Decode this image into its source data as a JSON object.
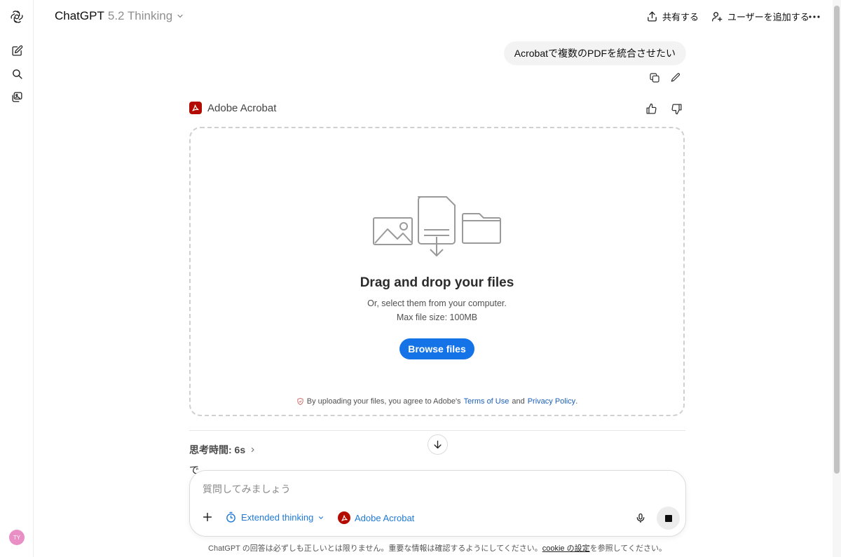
{
  "header": {
    "app_name": "ChatGPT",
    "model_label": "5.2 Thinking",
    "share_label": "共有する",
    "add_user_label": "ユーザーを追加する"
  },
  "sidebar": {
    "items": [
      {
        "icon": "chatgpt-logo-icon"
      },
      {
        "icon": "new-chat-icon"
      },
      {
        "icon": "search-icon"
      },
      {
        "icon": "library-icon"
      }
    ],
    "avatar_initials": "TY"
  },
  "conversation": {
    "user_message": "Acrobatで複数のPDFを統合させたい",
    "app_name": "Adobe Acrobat",
    "thinking_label": "思考時間: 6s",
    "partial_text": "で"
  },
  "dropzone": {
    "title": "Drag and drop your files",
    "subtitle": "Or, select them from your computer.",
    "max_size": "Max file size: 100MB",
    "browse_label": "Browse files",
    "terms_prefix": "By uploading your files, you agree to Adobe's",
    "terms_link": "Terms of Use",
    "terms_and": "and",
    "privacy_link": "Privacy Policy",
    "terms_suffix": "."
  },
  "composer": {
    "placeholder": "質問してみましょう",
    "extended_thinking_label": "Extended thinking",
    "tool_label": "Adobe Acrobat"
  },
  "footer": {
    "disclaimer_prefix": "ChatGPT の回答は必ずしも正しいとは限りません。重要な情報は確認するようにしてください。",
    "cookie_link": "cookie の設定",
    "disclaimer_suffix": "を参照してください。"
  },
  "colors": {
    "accent_blue": "#1473e6",
    "acrobat_red": "#b30b00",
    "link_blue": "#1b5fb8",
    "avatar_pink": "#e98fc6"
  }
}
